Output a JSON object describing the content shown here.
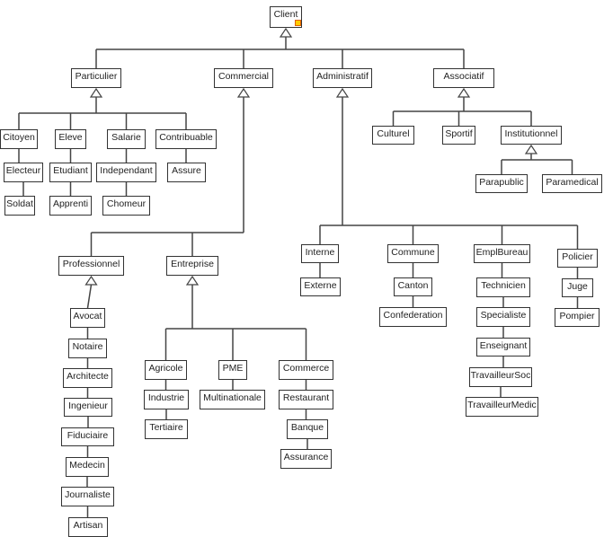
{
  "diagram_type": "UML class inheritance hierarchy",
  "colors": {
    "line": "#444444",
    "box_border": "#333333",
    "marker_fill": "#ffcc00",
    "marker_border": "#e06000"
  },
  "nodes": {
    "client": "Client",
    "particulier": "Particulier",
    "commercial": "Commercial",
    "administratif": "Administratif",
    "associatif": "Associatif",
    "citoyen": "Citoyen",
    "eleve": "Eleve",
    "salarie": "Salarie",
    "contribuable": "Contribuable",
    "electeur": "Electeur",
    "etudiant": "Etudiant",
    "independant": "Independant",
    "assure": "Assure",
    "soldat": "Soldat",
    "apprenti": "Apprenti",
    "chomeur": "Chomeur",
    "culturel": "Culturel",
    "sportif": "Sportif",
    "institutionnel": "Institutionnel",
    "parapublic": "Parapublic",
    "paramedical": "Paramedical",
    "professionnel": "Professionnel",
    "entreprise": "Entreprise",
    "avocat": "Avocat",
    "notaire": "Notaire",
    "architecte": "Architecte",
    "ingenieur": "Ingenieur",
    "fiduciaire": "Fiduciaire",
    "medecin": "Medecin",
    "journaliste": "Journaliste",
    "artisan": "Artisan",
    "agricole": "Agricole",
    "industrie": "Industrie",
    "tertiaire": "Tertiaire",
    "pme": "PME",
    "multinationale": "Multinationale",
    "commerce": "Commerce",
    "restaurant": "Restaurant",
    "banque": "Banque",
    "assurance": "Assurance",
    "interne": "Interne",
    "externe": "Externe",
    "commune": "Commune",
    "canton": "Canton",
    "confederation": "Confederation",
    "emplbureau": "EmplBureau",
    "technicien": "Technicien",
    "specialiste": "Specialiste",
    "enseignant": "Enseignant",
    "travailleursoc": "TravailleurSoc",
    "travailleurmedic": "TravailleurMedic",
    "policier": "Policier",
    "juge": "Juge",
    "pompier": "Pompier"
  },
  "inheritance": [
    {
      "parent": "client",
      "children": [
        "particulier",
        "commercial",
        "administratif",
        "associatif"
      ]
    },
    {
      "parent": "particulier",
      "children": [
        "citoyen",
        "eleve",
        "salarie",
        "contribuable"
      ]
    },
    {
      "parent": "commercial",
      "children": [
        "professionnel",
        "entreprise"
      ]
    },
    {
      "parent": "administratif",
      "children": [
        "interne",
        "commune",
        "emplbureau",
        "policier"
      ]
    },
    {
      "parent": "associatif",
      "children": [
        "culturel",
        "sportif",
        "institutionnel"
      ]
    },
    {
      "parent": "institutionnel",
      "children": [
        "parapublic",
        "paramedical"
      ]
    },
    {
      "parent": "professionnel",
      "children": [
        "avocat"
      ]
    },
    {
      "parent": "entreprise",
      "children": [
        "agricole",
        "pme",
        "commerce"
      ]
    }
  ],
  "associations": [
    [
      "citoyen",
      "electeur"
    ],
    [
      "electeur",
      "soldat"
    ],
    [
      "eleve",
      "etudiant"
    ],
    [
      "etudiant",
      "apprenti"
    ],
    [
      "salarie",
      "independant"
    ],
    [
      "independant",
      "chomeur"
    ],
    [
      "contribuable",
      "assure"
    ],
    [
      "avocat",
      "notaire"
    ],
    [
      "notaire",
      "architecte"
    ],
    [
      "architecte",
      "ingenieur"
    ],
    [
      "ingenieur",
      "fiduciaire"
    ],
    [
      "fiduciaire",
      "medecin"
    ],
    [
      "medecin",
      "journaliste"
    ],
    [
      "journaliste",
      "artisan"
    ],
    [
      "agricole",
      "industrie"
    ],
    [
      "industrie",
      "tertiaire"
    ],
    [
      "pme",
      "multinationale"
    ],
    [
      "commerce",
      "restaurant"
    ],
    [
      "restaurant",
      "banque"
    ],
    [
      "banque",
      "assurance"
    ],
    [
      "interne",
      "externe"
    ],
    [
      "commune",
      "canton"
    ],
    [
      "canton",
      "confederation"
    ],
    [
      "emplbureau",
      "technicien"
    ],
    [
      "technicien",
      "specialiste"
    ],
    [
      "specialiste",
      "enseignant"
    ],
    [
      "enseignant",
      "travailleursoc"
    ],
    [
      "travailleursoc",
      "travailleurmedic"
    ],
    [
      "policier",
      "juge"
    ],
    [
      "juge",
      "pompier"
    ]
  ]
}
